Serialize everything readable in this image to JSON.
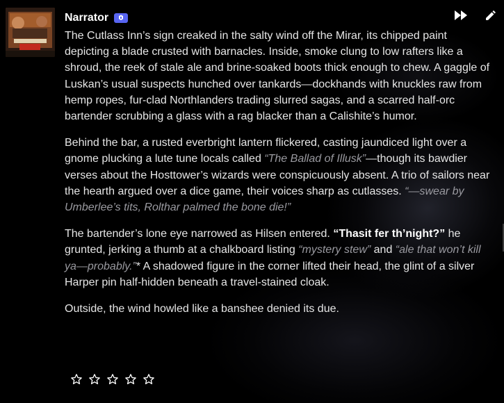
{
  "message": {
    "author": "Narrator",
    "avatar_icon": "tavern-sign-avatar",
    "badge_icon": "bot-badge-icon",
    "actions": {
      "continue_icon": "fast-forward-icon",
      "edit_icon": "pencil-icon"
    },
    "paragraphs": [
      {
        "segments": [
          {
            "text": "The Cutlass Inn’s sign creaked in the salty wind off the Mirar, its chipped paint depicting a blade crusted with barnacles. Inside, smoke clung to low rafters like a shroud, the reek of stale ale and brine-soaked boots thick enough to chew. A gaggle of Luskan’s usual suspects hunched over tankards—dockhands with knuckles raw from hemp ropes, fur-clad Northlanders trading slurred sagas, and a scarred half-orc bartender scrubbing a glass with a rag blacker than a Calishite’s humor."
          }
        ]
      },
      {
        "segments": [
          {
            "text": "Behind the bar, a rusted everbright lantern flickered, casting jaundiced light over a gnome plucking a lute tune locals called "
          },
          {
            "text": "“The Ballad of Illusk”"
          },
          {
            "text": "—though its bawdier verses about the Hosttower’s wizards were conspicuously absent. A trio of sailors near the hearth argued over a dice game, their voices sharp as cutlasses. "
          },
          {
            "text": "“—swear by Umberlee’s tits, Rolthar palmed the bone die!”"
          }
        ]
      },
      {
        "segments": [
          {
            "text": "The bartender’s lone eye narrowed as Hilsen entered. "
          },
          {
            "text": "“Thasit fer th’night?”"
          },
          {
            "text": " he grunted, jerking a thumb at a chalkboard listing "
          },
          {
            "text": "“mystery stew”"
          },
          {
            "text": " and "
          },
          {
            "text": "“ale that won’t kill ya—probably.”"
          },
          {
            "text": "* A shadowed figure in the corner lifted their head, the glint of a silver Harper pin half-hidden beneath a travel-stained cloak."
          }
        ]
      },
      {
        "segments": [
          {
            "text": "Outside, the wind howled like a banshee denied its due."
          }
        ]
      }
    ],
    "rating": {
      "max": 5,
      "value": 0,
      "star_icon": "star-outline-icon"
    }
  },
  "colors": {
    "background": "#000000",
    "text": "#e6e6e6",
    "quote": "#9a9aa0",
    "emphasis": "#ffffff",
    "badge": "#5865f2"
  }
}
